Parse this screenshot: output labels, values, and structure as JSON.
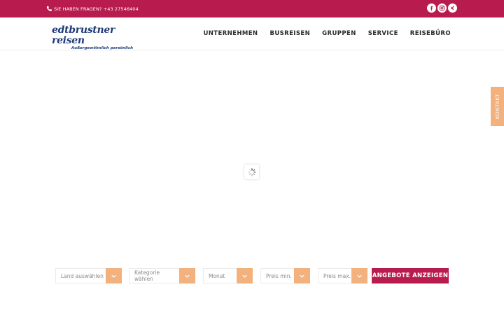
{
  "topbar": {
    "contact_text": "SIE HABEN FRAGEN? +43 27546404",
    "social": [
      "facebook-icon",
      "instagram-icon",
      "xing-icon"
    ]
  },
  "header": {
    "logo_text": "edtbrustner reisen",
    "logo_tagline": "Außergewöhnlich persönlich",
    "nav": [
      "UNTERNEHMEN",
      "BUSREISEN",
      "GRUPPEN",
      "SERVICE",
      "REISEBÜRO"
    ]
  },
  "side_tab": {
    "label": "KONTAKT"
  },
  "filters": [
    {
      "placeholder": "Land auswählen"
    },
    {
      "placeholder": "Kategorie wählen"
    },
    {
      "placeholder": "Monat"
    },
    {
      "placeholder": "Preis min."
    },
    {
      "placeholder": "Preis max."
    }
  ],
  "search_button": {
    "label": "ANGEBOTE ANZEIGEN"
  },
  "colors": {
    "brand": "#b81c4e",
    "accent": "#f3b27d",
    "logo": "#1e3a78"
  }
}
